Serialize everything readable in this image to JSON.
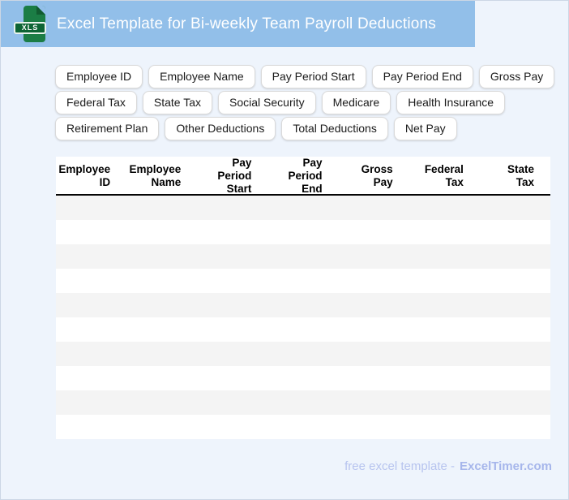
{
  "header": {
    "title": "Excel Template for Bi-weekly Team Payroll Deductions",
    "icon_label": "XLS",
    "bar_color": "#92bfe9",
    "icon_green": "#1b7d45"
  },
  "chips": {
    "rows": [
      [
        "Employee ID",
        "Employee Name",
        "Pay Period Start",
        "Pay Period End",
        "Gross Pay"
      ],
      [
        "Federal Tax",
        "State Tax",
        "Social Security",
        "Medicare",
        "Health Insurance"
      ],
      [
        "Retirement Plan",
        "Other Deductions",
        "Total Deductions",
        "Net Pay"
      ]
    ]
  },
  "table": {
    "columns": [
      {
        "line1": "Employee",
        "line2": "ID"
      },
      {
        "line1": "Employee",
        "line2": "Name"
      },
      {
        "line1": "Pay Period",
        "line2": "Start"
      },
      {
        "line1": "Pay Period",
        "line2": "End"
      },
      {
        "line1": "Gross",
        "line2": "Pay"
      },
      {
        "line1": "Federal",
        "line2": "Tax"
      },
      {
        "line1": "State",
        "line2": "Tax"
      }
    ],
    "empty_row_count": 10,
    "stripe_color": "#f4f4f4"
  },
  "footer": {
    "text": "free excel template -",
    "brand": "ExcelTimer.com"
  },
  "colors": {
    "page_background": "#eef4fc",
    "header_bar": "#92bfe9",
    "header_border": "#050505",
    "footer_text": "#b7c4ef",
    "footer_brand": "#a6b6eb"
  }
}
